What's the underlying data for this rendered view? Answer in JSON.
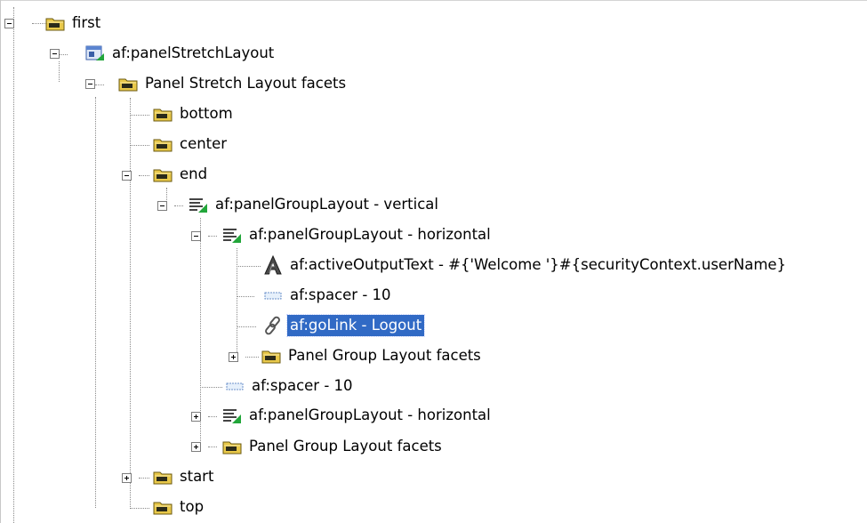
{
  "tree": {
    "first": "first",
    "panelStretch": "af:panelStretchLayout",
    "psFacets": "Panel Stretch Layout facets",
    "bottom": "bottom",
    "center": "center",
    "end": "end",
    "pglVertical": "af:panelGroupLayout - vertical",
    "pglHorizontal1": "af:panelGroupLayout - horizontal",
    "activeOutput": "af:activeOutputText - #{'Welcome '}#{securityContext.userName}",
    "spacerInner": "af:spacer - 10",
    "goLink": "af:goLink - Logout",
    "pglFacetsInner": "Panel Group Layout facets",
    "spacerOuter": "af:spacer - 10",
    "pglHorizontal2": "af:panelGroupLayout - horizontal",
    "pglFacetsOuter": "Panel Group Layout facets",
    "start": "start",
    "top": "top"
  },
  "selected": "af:goLink - Logout",
  "colors": {
    "selection": "#316ac5",
    "folder": "#e8c84a",
    "folderDark": "#2a2a1a"
  },
  "icons": {
    "folder": "folder-icon",
    "panelStretch": "panel-stretch-layout-icon",
    "pgl": "panel-group-layout-icon",
    "activeOutput": "active-output-text-icon",
    "spacer": "spacer-icon",
    "link": "link-icon"
  }
}
